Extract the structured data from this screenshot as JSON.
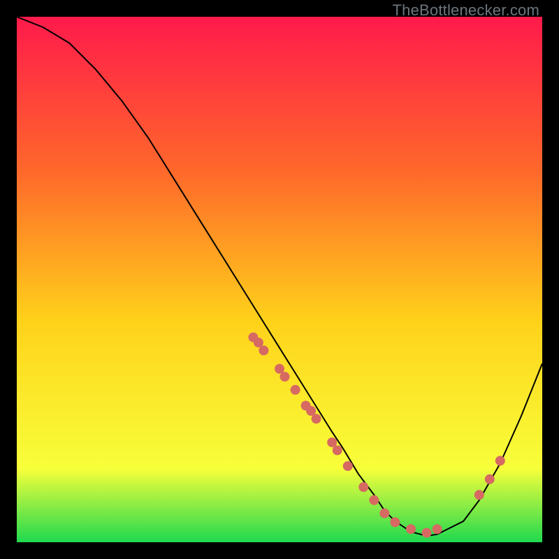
{
  "watermark": "TheBottlenecker.com",
  "colors": {
    "gradient_top": "#ff1a4b",
    "gradient_mid1": "#ff6a2a",
    "gradient_mid2": "#ffd21a",
    "gradient_mid3": "#f7ff3a",
    "gradient_bottom": "#1fd94f",
    "curve": "#000000",
    "dot": "#d66a62",
    "frame_bg": "#000000"
  },
  "chart_data": {
    "type": "line",
    "title": "",
    "xlabel": "",
    "ylabel": "",
    "xlim": [
      0,
      100
    ],
    "ylim": [
      0,
      100
    ],
    "x": [
      0,
      5,
      10,
      15,
      20,
      25,
      30,
      35,
      40,
      45,
      50,
      55,
      60,
      62,
      65,
      68,
      70,
      72,
      75,
      78,
      80,
      85,
      88,
      92,
      96,
      100
    ],
    "values": [
      100,
      98,
      95,
      90,
      84,
      77,
      69,
      61,
      53,
      45,
      37,
      29,
      21,
      18,
      13,
      9,
      6,
      4,
      2,
      1.2,
      1.5,
      4,
      8,
      15,
      24,
      34
    ],
    "dots_x": [
      45,
      46,
      47,
      50,
      51,
      53,
      55,
      56,
      57,
      60,
      61,
      63,
      66,
      68,
      70,
      72,
      75,
      78,
      80,
      88,
      90,
      92
    ],
    "dots_y": [
      39,
      38,
      36.5,
      33,
      31.5,
      29,
      26,
      25,
      23.5,
      19,
      17.5,
      14.5,
      10.5,
      8,
      5.5,
      3.8,
      2.5,
      1.8,
      2.5,
      9,
      12,
      15.5
    ]
  }
}
